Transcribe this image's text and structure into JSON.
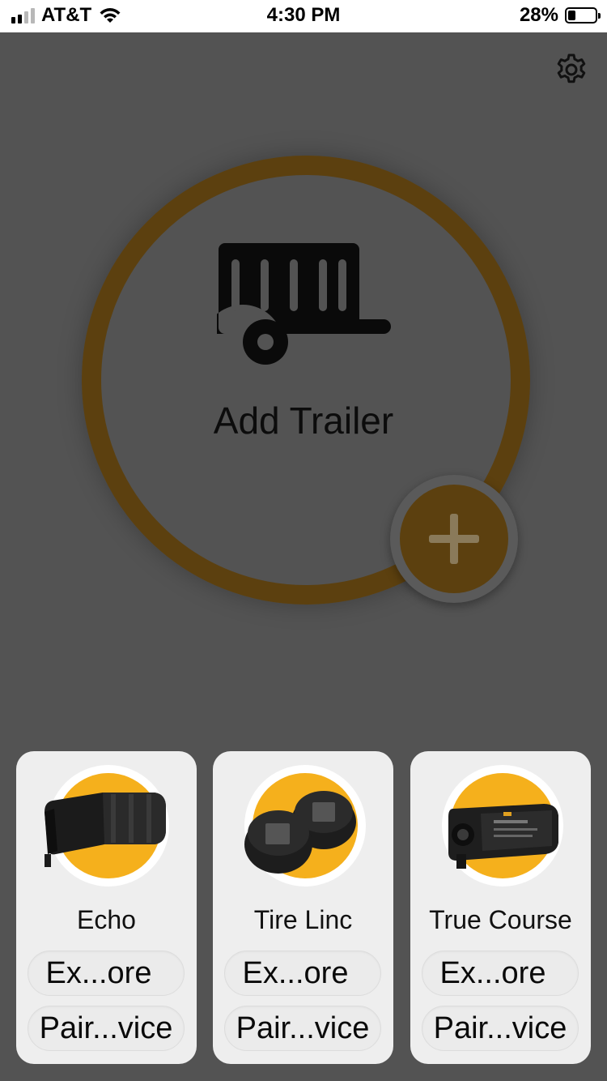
{
  "status_bar": {
    "carrier": "AT&T",
    "time": "4:30 PM",
    "battery_percent": "28%",
    "battery_level": 0.28
  },
  "header": {
    "settings_icon": "gear-icon"
  },
  "hero": {
    "label": "Add Trailer",
    "icon": "trailer-icon",
    "add_icon": "plus-icon",
    "ring_color": "#5c400f"
  },
  "products": [
    {
      "name": "Echo",
      "image": "echo-device",
      "explore_label": "Ex...ore",
      "pair_label": "Pair...vice"
    },
    {
      "name": "Tire Linc",
      "image": "tire-linc-sensors",
      "explore_label": "Ex...ore",
      "pair_label": "Pair...vice"
    },
    {
      "name": "True Course",
      "image": "true-course-device",
      "explore_label": "Ex...ore",
      "pair_label": "Pair...vice"
    }
  ],
  "colors": {
    "accent": "#f5b01c",
    "overlay_background": "#535353",
    "card_background": "#eeeeee"
  }
}
